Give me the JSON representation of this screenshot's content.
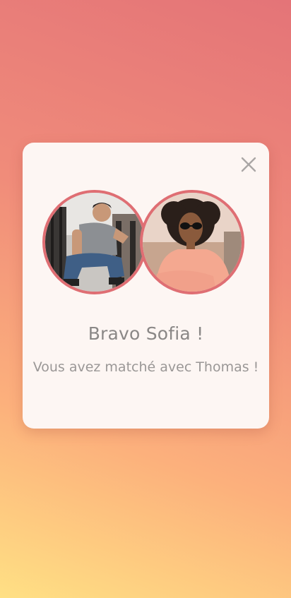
{
  "match_modal": {
    "title": "Bravo Sofia !",
    "message": "Vous avez matché avec Thomas !",
    "close_icon": "close-icon"
  },
  "colors": {
    "accent": "#df6e73",
    "modal_background": "#fdf6f3",
    "gradient_top": "#e47478",
    "gradient_bottom": "#ffe084",
    "text": "#8a8786"
  }
}
